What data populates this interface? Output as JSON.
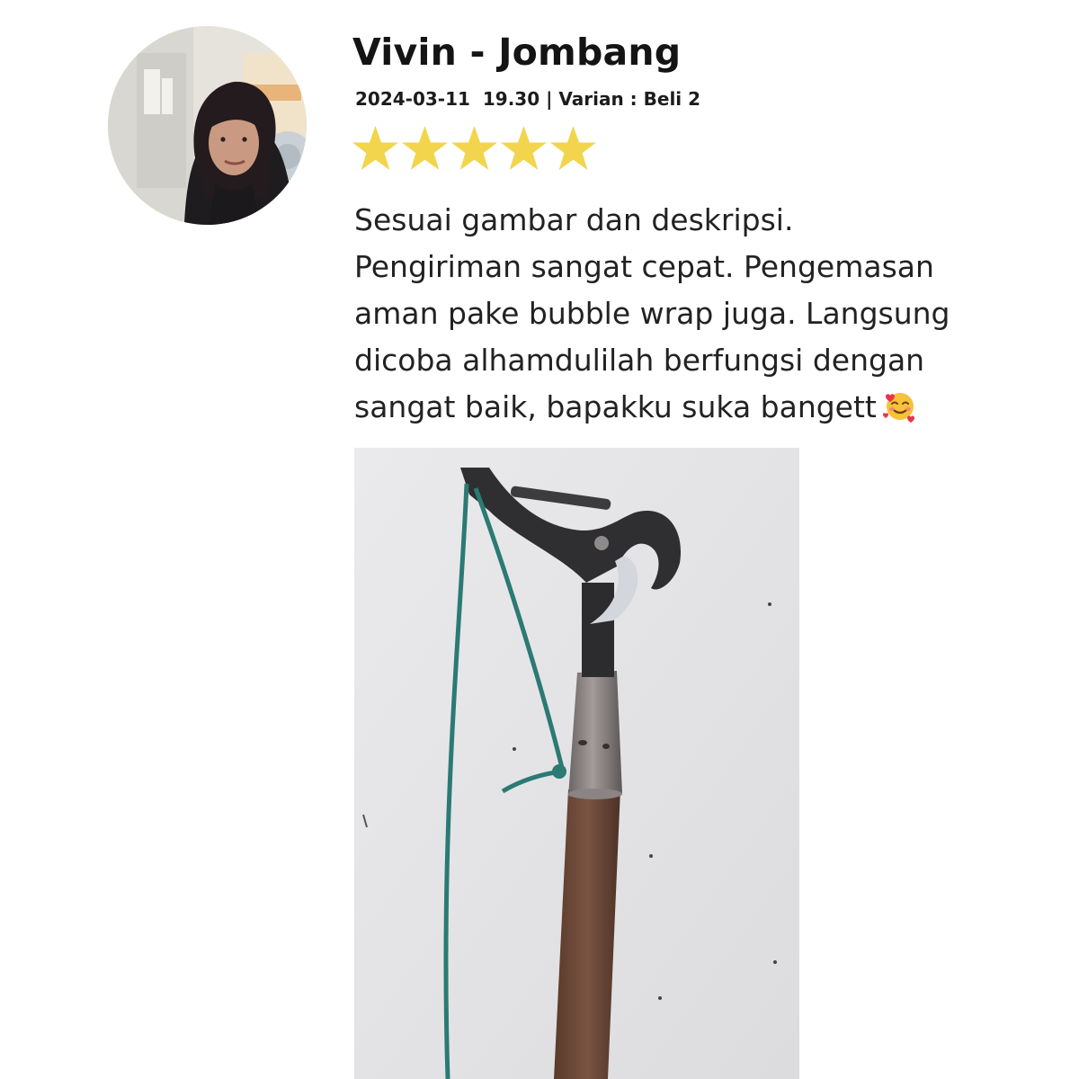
{
  "reviewer": {
    "name": "Vivin - Jombang",
    "avatar_icon": "reviewer-avatar"
  },
  "review_meta": {
    "date": "2024-03-11",
    "time": "19.30",
    "variant_label": "Varian : Beli 2"
  },
  "rating": {
    "value": 5,
    "max": 5,
    "star_color": "#F2D54C"
  },
  "review_text": {
    "line1": "Sesuai gambar dan deskripsi.",
    "line2": "Pengiriman sangat cepat. Pengemasan",
    "line3": "aman pake bubble wrap juga. Langsung",
    "line4": "dicoba alhamdulilah berfungsi dengan",
    "line5": "sangat baik, bapakku suka bangett",
    "emoji_icon": "smiling-face-with-hearts-icon"
  },
  "review_photo": {
    "icon": "pole-pruner-photo"
  }
}
